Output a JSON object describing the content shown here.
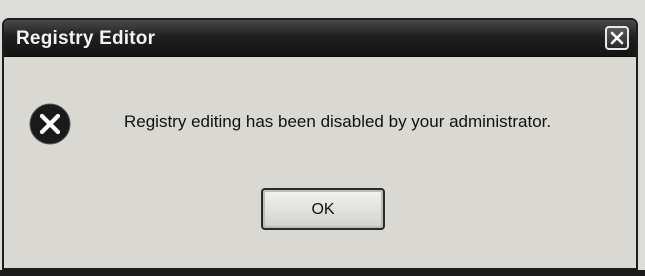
{
  "window": {
    "title": "Registry Editor",
    "close_icon": "close-icon"
  },
  "dialog": {
    "icon": "error-x-icon",
    "message": "Registry editing has been disabled by your administrator.",
    "ok_label": "OK"
  },
  "colors": {
    "titlebar": "#1c1c1c",
    "dialog_background": "#d9d8d3",
    "error_icon": "#1a1a1a"
  }
}
